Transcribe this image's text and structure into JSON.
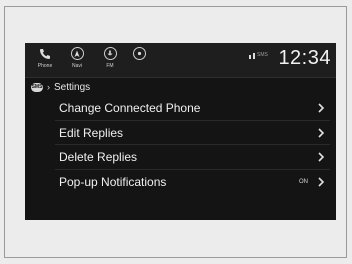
{
  "statusbar": {
    "buttons": [
      {
        "label": "Phone",
        "icon": "phone-icon"
      },
      {
        "label": "Navi",
        "icon": "navi-icon"
      },
      {
        "label": "FM",
        "icon": "fm-icon"
      },
      {
        "label": "",
        "icon": "source-icon"
      }
    ],
    "signal_text": "SMS",
    "clock": "12:34"
  },
  "breadcrumb": {
    "badge": "SMS",
    "title": "Settings"
  },
  "menu": [
    {
      "label": "Change Connected Phone",
      "value": ""
    },
    {
      "label": "Edit Replies",
      "value": ""
    },
    {
      "label": "Delete Replies",
      "value": ""
    },
    {
      "label": "Pop-up Notifications",
      "value": "ON"
    }
  ],
  "colors": {
    "background": "#141414",
    "text": "#f0f0f0",
    "frame": "#9a9a9a"
  }
}
